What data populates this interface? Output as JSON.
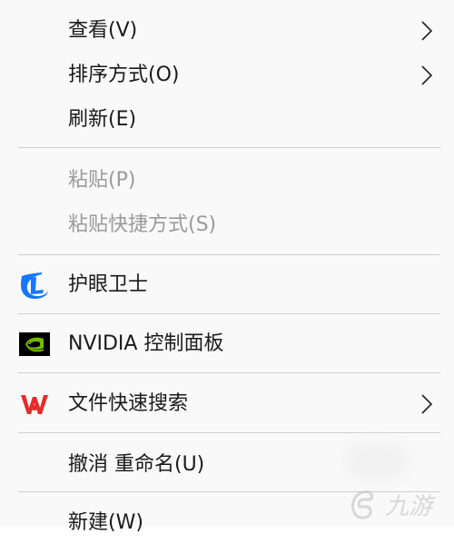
{
  "menu": {
    "items": [
      {
        "label": "查看(V)",
        "submenu": true
      },
      {
        "label": "排序方式(O)",
        "submenu": true
      },
      {
        "label": "刷新(E)"
      },
      {
        "label": "粘贴(P)",
        "disabled": true
      },
      {
        "label": "粘贴快捷方式(S)",
        "disabled": true
      },
      {
        "label": "护眼卫士",
        "icon": "eye-guard-icon"
      },
      {
        "label": "NVIDIA 控制面板",
        "icon": "nvidia-icon"
      },
      {
        "label": "文件快速搜索",
        "icon": "wps-icon",
        "submenu": true
      },
      {
        "label": "撤消 重命名(U)"
      },
      {
        "label": "新建(W)"
      }
    ]
  },
  "colors": {
    "menu_bg": "#f9f9f9",
    "text": "#1a1a1a",
    "disabled_text": "#9a9a9a",
    "separator": "#cfcfcf",
    "eye_guard_blue": "#1677ff",
    "nvidia_green": "#76b900",
    "wps_red": "#e52b2b"
  },
  "watermark": {
    "text": "九游"
  }
}
